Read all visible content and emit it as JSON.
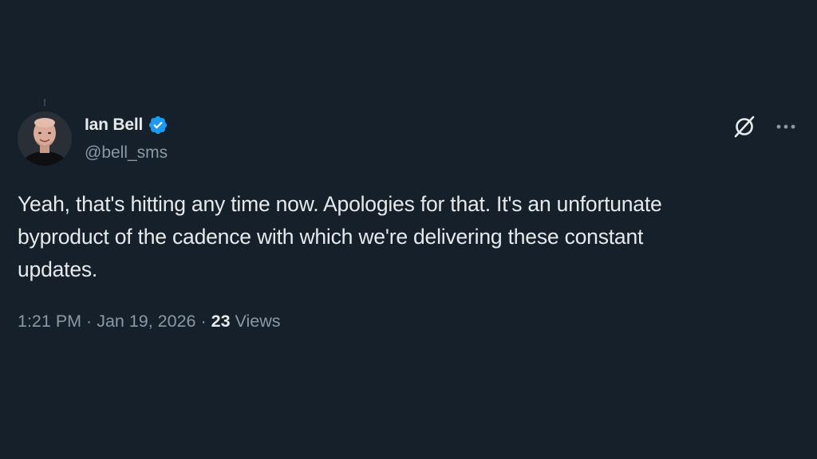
{
  "tweet": {
    "author": {
      "display_name": "Ian Bell",
      "handle": "@bell_sms",
      "verified": true,
      "verified_color": "#1d9bf0",
      "avatar_icon": "avatar-photo"
    },
    "text": "Yeah, that's hitting any time now. Apologies for that. It's an unfortunate\nbyproduct of the cadence with which we're delivering these constant\nupdates.",
    "time": "1:21 PM",
    "date": "Jan 19, 2026",
    "separator": " · ",
    "views_count": "23",
    "views_label": " Views",
    "actions": {
      "grok_icon": "grok-icon",
      "more_icon": "more-icon"
    }
  },
  "colors": {
    "background": "#15202b",
    "primary_text": "#e7e9ea",
    "secondary_text": "#8b98a5"
  }
}
